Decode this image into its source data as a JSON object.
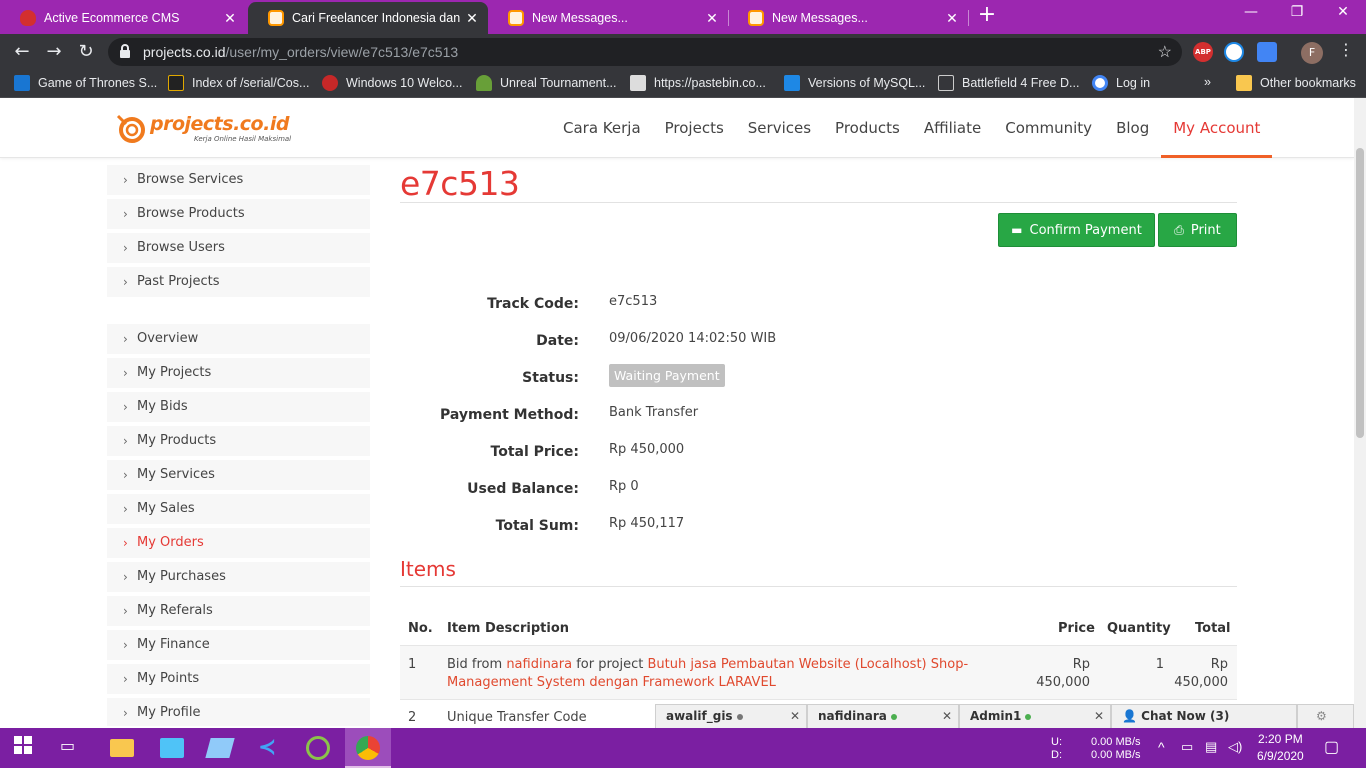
{
  "browser": {
    "tabs": [
      {
        "title": "Active Ecommerce CMS",
        "favicon": "red-bug-icon"
      },
      {
        "title": "Cari Freelancer Indonesia dan Pek",
        "favicon": "projects-logo-icon",
        "active": true
      },
      {
        "title": "New Messages...",
        "favicon": "projects-logo-icon"
      },
      {
        "title": "New Messages...",
        "favicon": "projects-logo-icon"
      }
    ],
    "url_host": "projects.co.id",
    "url_path": "/user/my_orders/view/e7c513/e7c513",
    "extensions": {
      "abp": "ABP",
      "profile_initial": "F"
    },
    "bookmarks": [
      "Game of Thrones S...",
      "Index of /serial/Cos...",
      "Windows 10 Welco...",
      "Unreal Tournament...",
      "https://pastebin.co...",
      "Versions of MySQL...",
      "Battlefield 4 Free D...",
      "Log in"
    ],
    "bookmarks_overflow": "»",
    "other_bookmarks": "Other bookmarks"
  },
  "site": {
    "logo_text": "projects.co.id",
    "logo_tagline": "Kerja Online Hasil Maksimal",
    "nav": [
      "Cara Kerja",
      "Projects",
      "Services",
      "Products",
      "Affiliate",
      "Community",
      "Blog",
      "My Account"
    ],
    "nav_active": "My Account",
    "accent_color": "#e53935",
    "button_color": "#28a745"
  },
  "sidebar": {
    "group1": [
      "Browse Services",
      "Browse Products",
      "Browse Users",
      "Past Projects"
    ],
    "group2": [
      "Overview",
      "My Projects",
      "My Bids",
      "My Products",
      "My Services",
      "My Sales",
      "My Orders",
      "My Purchases",
      "My Referals",
      "My Finance",
      "My Points",
      "My Profile"
    ],
    "active": "My Orders"
  },
  "order": {
    "title": "e7c513",
    "buttons": {
      "confirm": "Confirm Payment",
      "print": "Print"
    },
    "fields": [
      {
        "label": "Track Code:",
        "value": "e7c513"
      },
      {
        "label": "Date:",
        "value": "09/06/2020 14:02:50 WIB"
      },
      {
        "label": "Status:",
        "value": "Waiting Payment"
      },
      {
        "label": "Payment Method:",
        "value": "Bank Transfer"
      },
      {
        "label": "Total Price:",
        "value": "Rp 450,000"
      },
      {
        "label": "Used Balance:",
        "value": "Rp 0"
      },
      {
        "label": "Total Sum:",
        "value": "Rp 450,117"
      }
    ]
  },
  "items": {
    "title": "Items",
    "headers": {
      "no": "No.",
      "desc": "Item Description",
      "price": "Price",
      "qty": "Quantity",
      "total": "Total"
    },
    "rows": [
      {
        "no": "1",
        "desc_prefix": "Bid from",
        "user": "nafidinara",
        "desc_mid": "for project",
        "project": "Butuh jasa Pembautan Website (Localhost) Shop-Management System dengan Framework LARAVEL",
        "price_cur": "Rp",
        "price": "450,000",
        "qty": "1",
        "total_cur": "Rp",
        "total": "450,000"
      },
      {
        "no": "2",
        "desc": "Unique Transfer Code"
      }
    ]
  },
  "chat": {
    "tabs": [
      {
        "name": "awalif_gis",
        "status": "offline"
      },
      {
        "name": "nafidinara",
        "status": "online"
      },
      {
        "name": "Admin1",
        "status": "online"
      }
    ],
    "chat_now": "Chat Now (3)"
  },
  "taskbar": {
    "net_up_label": "U:",
    "net_down_label": "D:",
    "net_up": "0.00 MB/s",
    "net_down": "0.00 MB/s",
    "time": "2:20 PM",
    "date": "6/9/2020"
  }
}
